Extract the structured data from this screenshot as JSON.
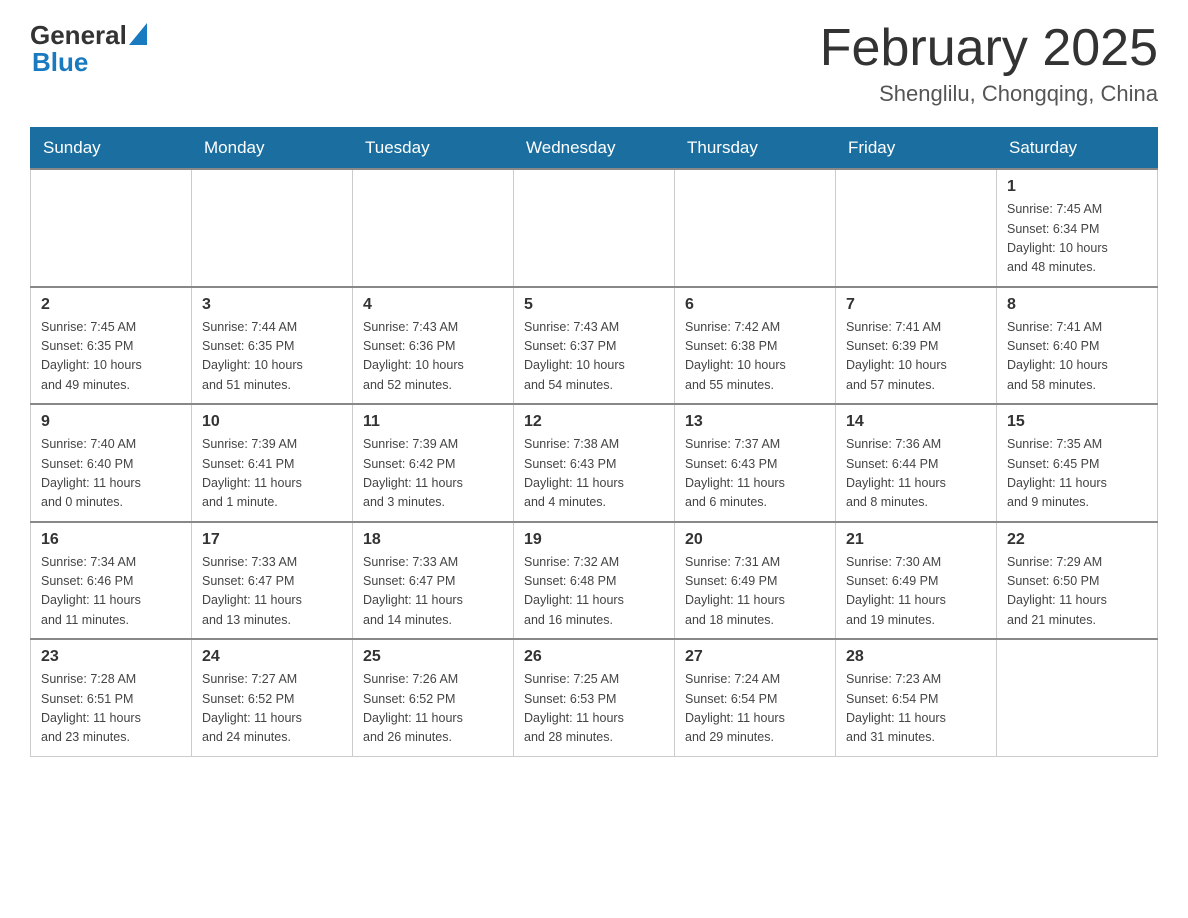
{
  "header": {
    "logo_general": "General",
    "logo_blue": "Blue",
    "title": "February 2025",
    "subtitle": "Shenglilu, Chongqing, China"
  },
  "days_of_week": [
    "Sunday",
    "Monday",
    "Tuesday",
    "Wednesday",
    "Thursday",
    "Friday",
    "Saturday"
  ],
  "weeks": [
    {
      "days": [
        {
          "num": "",
          "info": ""
        },
        {
          "num": "",
          "info": ""
        },
        {
          "num": "",
          "info": ""
        },
        {
          "num": "",
          "info": ""
        },
        {
          "num": "",
          "info": ""
        },
        {
          "num": "",
          "info": ""
        },
        {
          "num": "1",
          "info": "Sunrise: 7:45 AM\nSunset: 6:34 PM\nDaylight: 10 hours\nand 48 minutes."
        }
      ]
    },
    {
      "days": [
        {
          "num": "2",
          "info": "Sunrise: 7:45 AM\nSunset: 6:35 PM\nDaylight: 10 hours\nand 49 minutes."
        },
        {
          "num": "3",
          "info": "Sunrise: 7:44 AM\nSunset: 6:35 PM\nDaylight: 10 hours\nand 51 minutes."
        },
        {
          "num": "4",
          "info": "Sunrise: 7:43 AM\nSunset: 6:36 PM\nDaylight: 10 hours\nand 52 minutes."
        },
        {
          "num": "5",
          "info": "Sunrise: 7:43 AM\nSunset: 6:37 PM\nDaylight: 10 hours\nand 54 minutes."
        },
        {
          "num": "6",
          "info": "Sunrise: 7:42 AM\nSunset: 6:38 PM\nDaylight: 10 hours\nand 55 minutes."
        },
        {
          "num": "7",
          "info": "Sunrise: 7:41 AM\nSunset: 6:39 PM\nDaylight: 10 hours\nand 57 minutes."
        },
        {
          "num": "8",
          "info": "Sunrise: 7:41 AM\nSunset: 6:40 PM\nDaylight: 10 hours\nand 58 minutes."
        }
      ]
    },
    {
      "days": [
        {
          "num": "9",
          "info": "Sunrise: 7:40 AM\nSunset: 6:40 PM\nDaylight: 11 hours\nand 0 minutes."
        },
        {
          "num": "10",
          "info": "Sunrise: 7:39 AM\nSunset: 6:41 PM\nDaylight: 11 hours\nand 1 minute."
        },
        {
          "num": "11",
          "info": "Sunrise: 7:39 AM\nSunset: 6:42 PM\nDaylight: 11 hours\nand 3 minutes."
        },
        {
          "num": "12",
          "info": "Sunrise: 7:38 AM\nSunset: 6:43 PM\nDaylight: 11 hours\nand 4 minutes."
        },
        {
          "num": "13",
          "info": "Sunrise: 7:37 AM\nSunset: 6:43 PM\nDaylight: 11 hours\nand 6 minutes."
        },
        {
          "num": "14",
          "info": "Sunrise: 7:36 AM\nSunset: 6:44 PM\nDaylight: 11 hours\nand 8 minutes."
        },
        {
          "num": "15",
          "info": "Sunrise: 7:35 AM\nSunset: 6:45 PM\nDaylight: 11 hours\nand 9 minutes."
        }
      ]
    },
    {
      "days": [
        {
          "num": "16",
          "info": "Sunrise: 7:34 AM\nSunset: 6:46 PM\nDaylight: 11 hours\nand 11 minutes."
        },
        {
          "num": "17",
          "info": "Sunrise: 7:33 AM\nSunset: 6:47 PM\nDaylight: 11 hours\nand 13 minutes."
        },
        {
          "num": "18",
          "info": "Sunrise: 7:33 AM\nSunset: 6:47 PM\nDaylight: 11 hours\nand 14 minutes."
        },
        {
          "num": "19",
          "info": "Sunrise: 7:32 AM\nSunset: 6:48 PM\nDaylight: 11 hours\nand 16 minutes."
        },
        {
          "num": "20",
          "info": "Sunrise: 7:31 AM\nSunset: 6:49 PM\nDaylight: 11 hours\nand 18 minutes."
        },
        {
          "num": "21",
          "info": "Sunrise: 7:30 AM\nSunset: 6:49 PM\nDaylight: 11 hours\nand 19 minutes."
        },
        {
          "num": "22",
          "info": "Sunrise: 7:29 AM\nSunset: 6:50 PM\nDaylight: 11 hours\nand 21 minutes."
        }
      ]
    },
    {
      "days": [
        {
          "num": "23",
          "info": "Sunrise: 7:28 AM\nSunset: 6:51 PM\nDaylight: 11 hours\nand 23 minutes."
        },
        {
          "num": "24",
          "info": "Sunrise: 7:27 AM\nSunset: 6:52 PM\nDaylight: 11 hours\nand 24 minutes."
        },
        {
          "num": "25",
          "info": "Sunrise: 7:26 AM\nSunset: 6:52 PM\nDaylight: 11 hours\nand 26 minutes."
        },
        {
          "num": "26",
          "info": "Sunrise: 7:25 AM\nSunset: 6:53 PM\nDaylight: 11 hours\nand 28 minutes."
        },
        {
          "num": "27",
          "info": "Sunrise: 7:24 AM\nSunset: 6:54 PM\nDaylight: 11 hours\nand 29 minutes."
        },
        {
          "num": "28",
          "info": "Sunrise: 7:23 AM\nSunset: 6:54 PM\nDaylight: 11 hours\nand 31 minutes."
        },
        {
          "num": "",
          "info": ""
        }
      ]
    }
  ]
}
